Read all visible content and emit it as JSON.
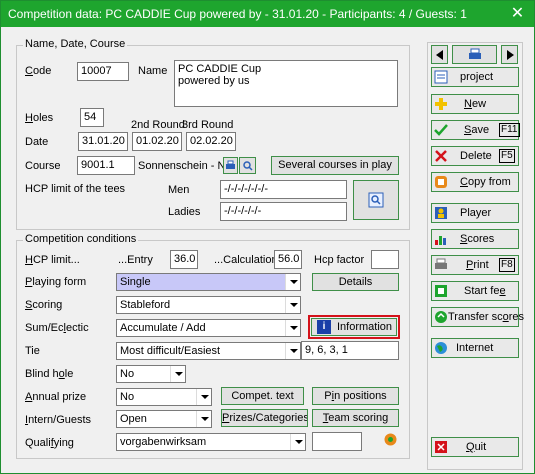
{
  "window": {
    "title": "Competition data: PC CADDIE Cup powered by - 31.01.20 - Participants: 4 / Guests: 1",
    "close_label": "✕"
  },
  "section_name": {
    "legend": "Name, Date, Course",
    "code_label": "Code",
    "code_value": "10007",
    "name_label": "Name",
    "name_value_line1": "PC CADDIE Cup",
    "name_value_line2": "powered by us",
    "holes_label": "Holes",
    "holes_value": "54",
    "date_label": "Date",
    "round2_label": "2nd Round",
    "round3_label": "3rd Round",
    "date1": "31.01.20",
    "date2": "01.02.20",
    "date3": "02.02.20",
    "course_label": "Course",
    "course_value": "9001.1",
    "course_name": "Sonnenschein - N",
    "several_courses_label": "Several courses in play",
    "hcp_limit_tees_label": "HCP limit of the tees",
    "men_label": "Men",
    "men_value": "-/-/-/-/-/-/-",
    "ladies_label": "Ladies",
    "ladies_value": "-/-/-/-/-/-"
  },
  "section_conditions": {
    "legend": "Competition conditions",
    "hcp_limit_label": "HCP limit...",
    "entry_label": "...Entry",
    "entry_value": "36.0",
    "calc_label": "...Calculation",
    "calc_value": "56.0",
    "hcp_factor_label": "Hcp factor",
    "hcp_factor_value": "",
    "playing_form_label": "Playing form",
    "playing_form_value": "Single",
    "details_label": "Details",
    "scoring_label": "Scoring",
    "scoring_value": "Stableford",
    "sum_label": "Sum/Eclectic",
    "sum_value": "Accumulate / Add",
    "information_label": "Information",
    "tie_label": "Tie",
    "tie_value": "Most difficult/Easiest",
    "tie_holes": "9, 6, 3, 1",
    "blind_hole_label": "Blind hole",
    "blind_hole_value": "No",
    "annual_prize_label": "Annual prize",
    "annual_prize_value": "No",
    "compet_text_label": "Compet. text",
    "pin_positions_label": "Pin positions",
    "intern_label": "Intern/Guests",
    "intern_value": "Open",
    "prizes_label": "Prizes/Categories",
    "team_scoring_label": "Team scoring",
    "qualifying_label": "Qualifying",
    "qualifying_value": "vorgabenwirksam",
    "qualifying_extra": ""
  },
  "sidebar": {
    "project": "project",
    "new": "New",
    "save": "Save",
    "save_key": "F11",
    "delete": "Delete",
    "delete_key": "F5",
    "copy_from": "Copy from",
    "player": "Player",
    "scores": "Scores",
    "print": "Print",
    "print_key": "F8",
    "start_fee": "Start fee",
    "transfer_scores": "Transfer scores",
    "internet": "Internet",
    "quit": "Quit"
  },
  "colors": {
    "titlebar": "#1ea52e",
    "highlight_border": "#d4121a",
    "selected_field": "#c8c8f8"
  }
}
